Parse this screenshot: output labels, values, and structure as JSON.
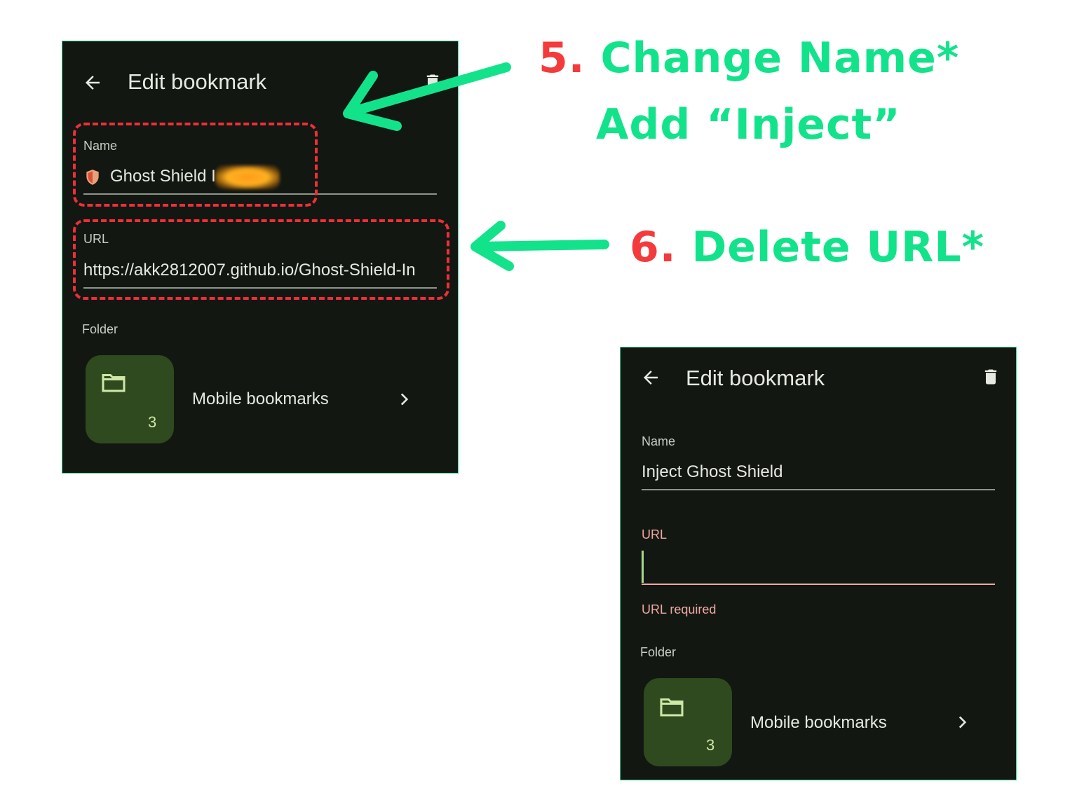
{
  "before_screen": {
    "title": "Edit bookmark",
    "name_label": "Name",
    "name_value": "Ghost Shield I",
    "url_label": "URL",
    "url_value": "https://akk2812007.github.io/Ghost-Shield-In",
    "folder_label": "Folder",
    "folder_name": "Mobile bookmarks",
    "folder_count": "3"
  },
  "after_screen": {
    "title": "Edit bookmark",
    "name_label": "Name",
    "name_value": "Inject Ghost Shield",
    "url_label": "URL",
    "url_value": "",
    "url_error": "URL required",
    "folder_label": "Folder",
    "folder_name": "Mobile bookmarks",
    "folder_count": "3"
  },
  "annotations": {
    "step5_number": "5.",
    "step5_text": "Change Name*",
    "step5_line2": "Add “Inject”",
    "step6_number": "6.",
    "step6_text": "Delete URL*"
  },
  "colors": {
    "panel_bg": "#121712",
    "annotation_green": "#12e38a",
    "annotation_red": "#f43a3a",
    "dashed_box": "#f02e38",
    "folder_tile": "#2f4a1f",
    "error_text": "#f0a8a2"
  },
  "icons": {
    "back": "arrow-left-icon",
    "delete": "trash-icon",
    "folder": "folder-icon",
    "chevron": "chevron-right-icon",
    "favicon": "shield-icon"
  }
}
